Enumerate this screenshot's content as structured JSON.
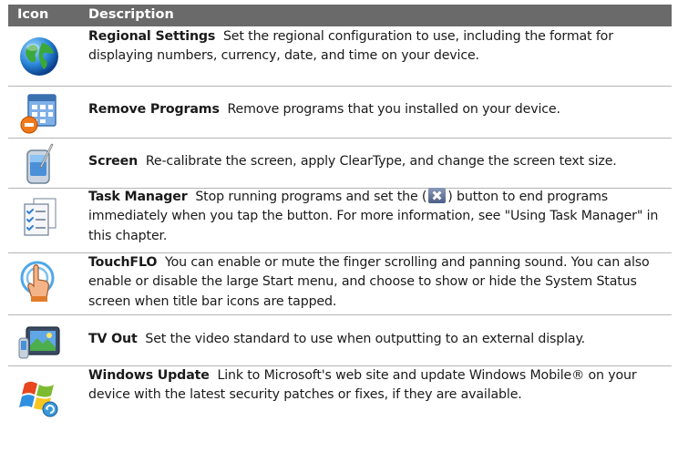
{
  "header": {
    "icon_col": "Icon",
    "description_col": "Description"
  },
  "rows": [
    {
      "title": "Regional Settings",
      "text": "Set the regional configuration to use, including the format for displaying numbers, currency, date, and time on your device."
    },
    {
      "title": "Remove Programs",
      "text": "Remove programs that you installed on your device."
    },
    {
      "title": "Screen",
      "text": "Re-calibrate the screen, apply ClearType, and change the screen text size."
    },
    {
      "title": "Task Manager",
      "text_before": "Stop running programs and set the (",
      "text_after": ") button to end programs immediately when you tap the button. For more information, see \"Using Task Manager\" in this chapter."
    },
    {
      "title": "TouchFLO",
      "text": "You can enable or mute the finger scrolling and panning sound. You can also enable or disable the large Start menu, and choose to show or hide the System Status screen when title bar icons are tapped."
    },
    {
      "title": "TV Out",
      "text": "Set the video standard to use when outputting to an external display."
    },
    {
      "title": "Windows Update",
      "text": "Link to Microsoft's web site and update Windows Mobile® on your device with the latest security patches or fixes, if they are available."
    }
  ]
}
